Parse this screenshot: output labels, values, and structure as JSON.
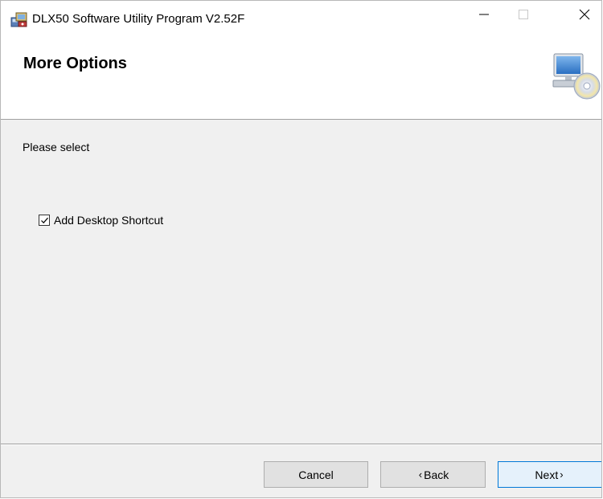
{
  "window": {
    "title": "DLX50 Software Utility Program V2.52F",
    "app_icon": "installer-icon",
    "controls": {
      "minimize_icon": "minimize-icon",
      "maximize_icon": "maximize-icon",
      "close_icon": "close-icon"
    }
  },
  "banner": {
    "title": "More Options",
    "icon": "computer-cd-icon"
  },
  "body": {
    "prompt": "Please select",
    "options": [
      {
        "label": "Add Desktop Shortcut",
        "checked": true
      }
    ]
  },
  "footer": {
    "cancel_label": "Cancel",
    "back_label": "Back",
    "back_chevron": "‹",
    "next_label": "Next",
    "next_chevron": "›"
  },
  "colors": {
    "accent": "#0078d7",
    "panel": "#f0f0f0",
    "banner": "#ffffff"
  }
}
